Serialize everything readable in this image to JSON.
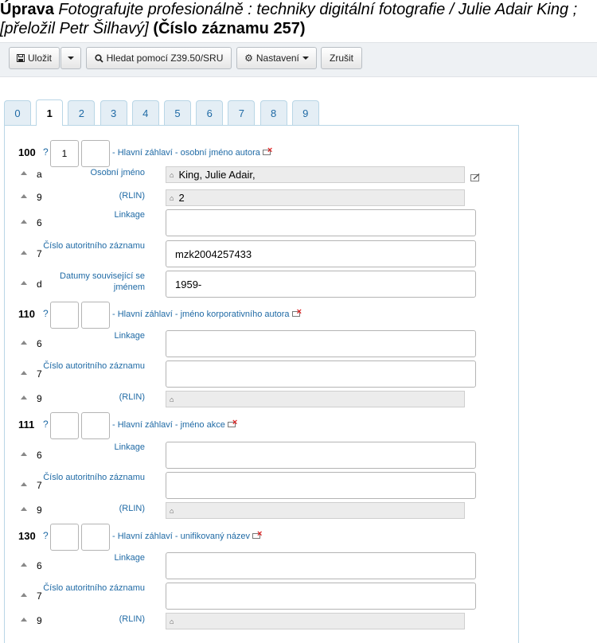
{
  "title": {
    "prefix": "Úprava",
    "record": "Fotografujte profesionálně : techniky digitální fotografie / Julie Adair King ; [přeložil Petr Šilhavý]",
    "suffix": "(Číslo záznamu 257)"
  },
  "toolbar": {
    "save": "Uložit",
    "z3950": "Hledat pomocí Z39.50/SRU",
    "settings": "Nastavení",
    "cancel": "Zrušit"
  },
  "tabs": [
    "0",
    "1",
    "2",
    "3",
    "4",
    "5",
    "6",
    "7",
    "8",
    "9"
  ],
  "active_tab": "1",
  "help_mark": "?",
  "fields": [
    {
      "tag": "100",
      "ind1": "1",
      "ind2": "",
      "label": "- Hlavní záhlaví - osobní jméno autora",
      "subfields": [
        {
          "code": "a",
          "label": "Osobní jméno",
          "value": "King, Julie Adair,",
          "type": "readonly"
        },
        {
          "code": "9",
          "label": "(RLIN)",
          "value": "2",
          "type": "readonly"
        },
        {
          "code": "6",
          "label": "Linkage",
          "value": "",
          "type": "input"
        },
        {
          "code": "7",
          "label": "Číslo autoritního záznamu",
          "value": "mzk2004257433",
          "type": "input"
        },
        {
          "code": "d",
          "label": "Datumy související se jménem",
          "value": "1959-",
          "type": "input"
        }
      ]
    },
    {
      "tag": "110",
      "ind1": "",
      "ind2": "",
      "label": "- Hlavní záhlaví - jméno korporativního autora",
      "subfields": [
        {
          "code": "6",
          "label": "Linkage",
          "value": "",
          "type": "input"
        },
        {
          "code": "7",
          "label": "Číslo autoritního záznamu",
          "value": "",
          "type": "input"
        },
        {
          "code": "9",
          "label": "(RLIN)",
          "value": "",
          "type": "readonly"
        }
      ]
    },
    {
      "tag": "111",
      "ind1": "",
      "ind2": "",
      "label": "- Hlavní záhlaví - jméno akce",
      "subfields": [
        {
          "code": "6",
          "label": "Linkage",
          "value": "",
          "type": "input"
        },
        {
          "code": "7",
          "label": "Číslo autoritního záznamu",
          "value": "",
          "type": "input"
        },
        {
          "code": "9",
          "label": "(RLIN)",
          "value": "",
          "type": "readonly"
        }
      ]
    },
    {
      "tag": "130",
      "ind1": "",
      "ind2": "",
      "label": "- Hlavní záhlaví - unifikovaný název",
      "subfields": [
        {
          "code": "6",
          "label": "Linkage",
          "value": "",
          "type": "input"
        },
        {
          "code": "7",
          "label": "Číslo autoritního záznamu",
          "value": "",
          "type": "input"
        },
        {
          "code": "9",
          "label": "(RLIN)",
          "value": "",
          "type": "readonly"
        }
      ]
    }
  ]
}
